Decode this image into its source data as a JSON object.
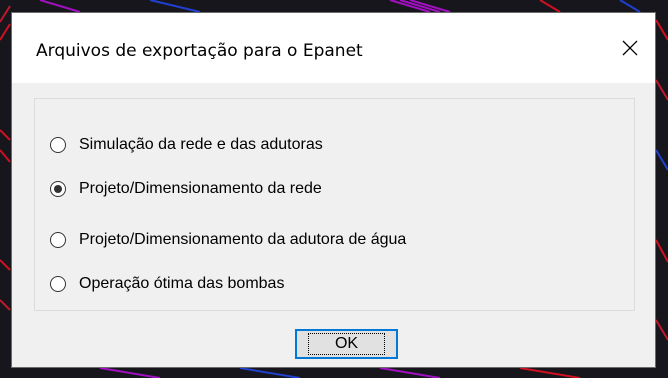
{
  "dialog": {
    "title": "Arquivos de exportação para o Epanet",
    "close_icon": "close-icon",
    "options": [
      {
        "label": "Simulação da rede e das adutoras",
        "selected": false
      },
      {
        "label": "Projeto/Dimensionamento da rede",
        "selected": true
      },
      {
        "label": "Projeto/Dimensionamento da adutora de água",
        "selected": false
      },
      {
        "label": "Operação ótima das bombas",
        "selected": false
      }
    ],
    "ok_label": "OK"
  },
  "colors": {
    "focus_border": "#0078d7",
    "dialog_bg": "#f0f0f0",
    "titlebar_bg": "#ffffff"
  }
}
